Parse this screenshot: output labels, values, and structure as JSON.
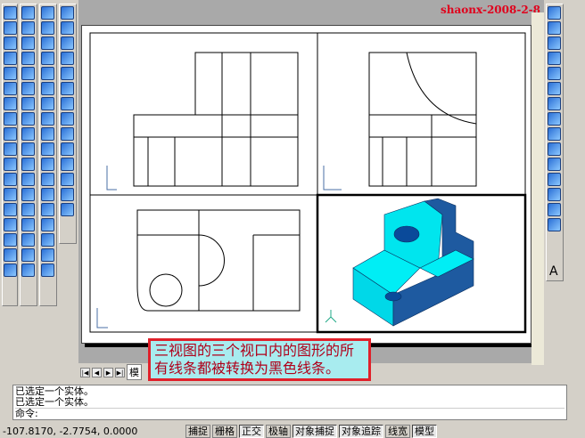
{
  "watermark": "shaonx-2008-2-8",
  "caption": {
    "line1": "三视图的三个视口内的图形的所",
    "line2": "有线条都被转换为黑色线条。"
  },
  "tabs": {
    "model": "模"
  },
  "command": {
    "history": [
      "已选定一个实体。",
      "已选定一个实体。"
    ],
    "prompt": "命令:"
  },
  "status": {
    "coords": "-107.8170, -2.7754, 0.0000",
    "buttons": [
      {
        "label": "捕捉",
        "on": false
      },
      {
        "label": "栅格",
        "on": false
      },
      {
        "label": "正交",
        "on": true
      },
      {
        "label": "极轴",
        "on": false
      },
      {
        "label": "对象捕捉",
        "on": true
      },
      {
        "label": "对象追踪",
        "on": true
      },
      {
        "label": "线宽",
        "on": false
      },
      {
        "label": "模型",
        "on": true
      }
    ]
  },
  "colors": {
    "solid_face": "#00e5ee",
    "solid_dark": "#1e5aa0",
    "caption_border": "#e0202a",
    "watermark": "#e0001c"
  },
  "right_toolbar": {
    "text_tool": "A"
  }
}
